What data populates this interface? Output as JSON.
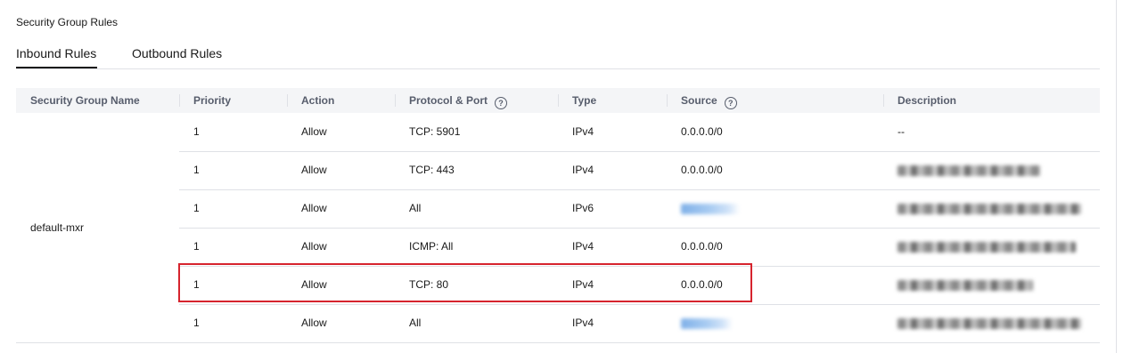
{
  "page": {
    "title": "Security Group Rules"
  },
  "tabs": [
    {
      "label": "Inbound Rules",
      "active": true
    },
    {
      "label": "Outbound Rules",
      "active": false
    }
  ],
  "table": {
    "columns": [
      "Security Group Name",
      "Priority",
      "Action",
      "Protocol & Port",
      "Type",
      "Source",
      "Description"
    ],
    "help_icon_glyph": "?",
    "group_name": "default-mxr",
    "rows": [
      {
        "priority": "1",
        "action": "Allow",
        "protocol": "TCP: 5901",
        "type": "IPv4",
        "source": "0.0.0.0/0",
        "description": "--"
      },
      {
        "priority": "1",
        "action": "Allow",
        "protocol": "TCP: 443",
        "type": "IPv4",
        "source": "0.0.0.0/0",
        "description": ""
      },
      {
        "priority": "1",
        "action": "Allow",
        "protocol": "All",
        "type": "IPv6",
        "source": "",
        "description": ""
      },
      {
        "priority": "1",
        "action": "Allow",
        "protocol": "ICMP: All",
        "type": "IPv4",
        "source": "0.0.0.0/0",
        "description": ""
      },
      {
        "priority": "1",
        "action": "Allow",
        "protocol": "TCP: 80",
        "type": "IPv4",
        "source": "0.0.0.0/0",
        "description": ""
      },
      {
        "priority": "1",
        "action": "Allow",
        "protocol": "All",
        "type": "IPv4",
        "source": "",
        "description": ""
      }
    ]
  },
  "colors": {
    "highlight": "#d6242e",
    "header_bg": "#f4f5f7",
    "border": "#dfe1e6"
  }
}
